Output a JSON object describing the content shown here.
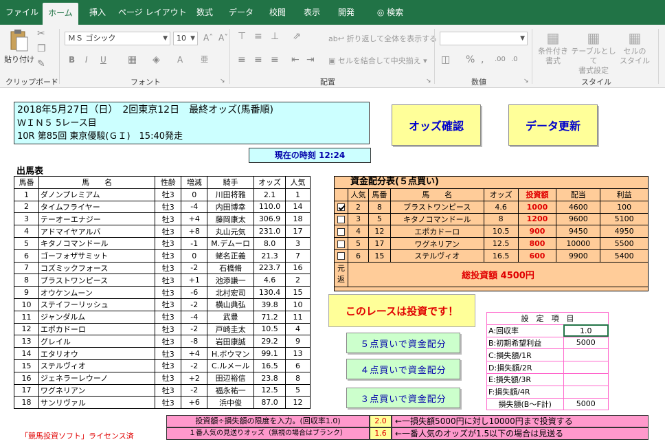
{
  "ribbon": {
    "tabs": [
      "ファイル",
      "ホーム",
      "挿入",
      "ページ レイアウト",
      "数式",
      "データ",
      "校閲",
      "表示",
      "開発",
      "検索"
    ],
    "active_tab": "ホーム",
    "groups": {
      "clipboard": "クリップボード",
      "font": "フォント",
      "alignment": "配置",
      "number": "数値",
      "styles": "スタイル"
    },
    "paste_label": "貼り付け",
    "font_name": "ＭＳ ゴシック",
    "font_size": "10",
    "wrap_text": "折り返して全体を表示する",
    "merge_center": "セルを結合して中央揃え",
    "cond_format": [
      "条件付き",
      "書式"
    ],
    "format_table": [
      "テーブルとして",
      "書式設定"
    ],
    "cell_styles": [
      "セルの",
      "スタイル"
    ]
  },
  "header": {
    "title": "2018年5月27日（日）　2回東京12日　最終オッズ(馬番順)",
    "line2": "ＷＩＮ５ 5レース目",
    "line3": "10R 第85回 東京優駿(ＧＩ)　15:40発走"
  },
  "buttons": {
    "odds_check": "オッズ確認",
    "data_update": "データ更新",
    "five": "５点買いで資金配分",
    "four": "４点買いで資金配分",
    "three": "３点買いで資金配分"
  },
  "time_label": "現在の時刻 12:24",
  "horse_table": {
    "title": "出馬表",
    "headers": [
      "馬番",
      "馬　　名",
      "性齢",
      "増減",
      "騎手",
      "オッズ",
      "人気"
    ],
    "rows": [
      [
        "1",
        "ダノンプレミアム",
        "牡3",
        "0",
        "川田将雅",
        "2.1",
        "1"
      ],
      [
        "2",
        "タイムフライヤー",
        "牡3",
        "-4",
        "内田博幸",
        "110.0",
        "14"
      ],
      [
        "3",
        "テーオーエナジー",
        "牡3",
        "+4",
        "藤岡康太",
        "306.9",
        "18"
      ],
      [
        "4",
        "アドマイヤアルバ",
        "牡3",
        "+8",
        "丸山元気",
        "231.0",
        "17"
      ],
      [
        "5",
        "キタノコマンドール",
        "牡3",
        "-1",
        "M.デムーロ",
        "8.0",
        "3"
      ],
      [
        "6",
        "ゴーフォザサミット",
        "牡3",
        "0",
        "蛯名正義",
        "21.3",
        "7"
      ],
      [
        "7",
        "コズミックフォース",
        "牡3",
        "-2",
        "石橋脩",
        "223.7",
        "16"
      ],
      [
        "8",
        "ブラストワンピース",
        "牡3",
        "+1",
        "池添謙一",
        "4.6",
        "2"
      ],
      [
        "9",
        "オウケンムーン",
        "牡3",
        "-6",
        "北村宏司",
        "130.4",
        "15"
      ],
      [
        "10",
        "ステイフーリッシュ",
        "牡3",
        "-2",
        "横山典弘",
        "39.8",
        "10"
      ],
      [
        "11",
        "ジャンダルム",
        "牡3",
        "-4",
        "武豊",
        "71.2",
        "11"
      ],
      [
        "12",
        "エポカドーロ",
        "牡3",
        "-2",
        "戸崎圭太",
        "10.5",
        "4"
      ],
      [
        "13",
        "グレイル",
        "牡3",
        "-8",
        "岩田康誠",
        "29.2",
        "9"
      ],
      [
        "14",
        "エタリオウ",
        "牡3",
        "+4",
        "H.ボウマン",
        "99.1",
        "13"
      ],
      [
        "15",
        "ステルヴィオ",
        "牡3",
        "-2",
        "C.ルメール",
        "16.5",
        "6"
      ],
      [
        "16",
        "ジェネラーレウーノ",
        "牡3",
        "+2",
        "田辺裕信",
        "23.8",
        "8"
      ],
      [
        "17",
        "ワグネリアン",
        "牡3",
        "-2",
        "福永祐一",
        "12.5",
        "5"
      ],
      [
        "18",
        "サンリヴァル",
        "牡3",
        "+6",
        "浜中俊",
        "87.0",
        "12"
      ]
    ]
  },
  "alloc_table": {
    "title": "資金配分表(５点買い)",
    "headers": [
      "人気",
      "馬番",
      "馬　　名",
      "オッズ",
      "投資額",
      "配当",
      "利益"
    ],
    "rows": [
      {
        "checked": true,
        "cells": [
          "2",
          "8",
          "ブラストワンピース",
          "4.6",
          "1000",
          "4600",
          "100"
        ]
      },
      {
        "checked": false,
        "cells": [
          "3",
          "5",
          "キタノコマンドール",
          "8",
          "1200",
          "9600",
          "5100"
        ]
      },
      {
        "checked": false,
        "cells": [
          "4",
          "12",
          "エポカドーロ",
          "10.5",
          "900",
          "9450",
          "4950"
        ]
      },
      {
        "checked": false,
        "cells": [
          "5",
          "17",
          "ワグネリアン",
          "12.5",
          "800",
          "10000",
          "5500"
        ]
      },
      {
        "checked": false,
        "cells": [
          "6",
          "15",
          "ステルヴィオ",
          "16.5",
          "600",
          "9900",
          "5400"
        ]
      }
    ],
    "side_label": "元返",
    "total": "総投資額 4500円"
  },
  "verdict": "このレースは投資です！",
  "settings": {
    "title": "設　定　項　目",
    "rows": [
      [
        "A:回収率",
        "1.0"
      ],
      [
        "B:初期希望利益",
        "5000"
      ],
      [
        "C:損失額/1R",
        ""
      ],
      [
        "D:損失額/2R",
        ""
      ],
      [
        "E:損失額/3R",
        ""
      ],
      [
        "F:損失額/4R",
        ""
      ],
      [
        "損失額(B〜F計)",
        "5000"
      ]
    ]
  },
  "footer": {
    "license": "「競馬投資ソフト」ライセンス済",
    "note1_label": "投資額÷損失額の限度を入力。(回収率1.0)",
    "note1_value": "2.0",
    "note1_desc": "←一損失額5000円に対し10000円まで投資する",
    "note2_label": "１番人気の見送りオッズ（無視の場合はブランク）",
    "note2_value": "1.6",
    "note2_desc": "←一番人気のオッズが1.5以下の場合は見送る"
  },
  "colors": {
    "excel_green": "#217346",
    "cyan": "#ccffff",
    "yellow": "#ffff99",
    "orange": "#ffcc99",
    "pink": "#ff99cc",
    "green_btn": "#ccffcc",
    "red": "#e00000"
  }
}
